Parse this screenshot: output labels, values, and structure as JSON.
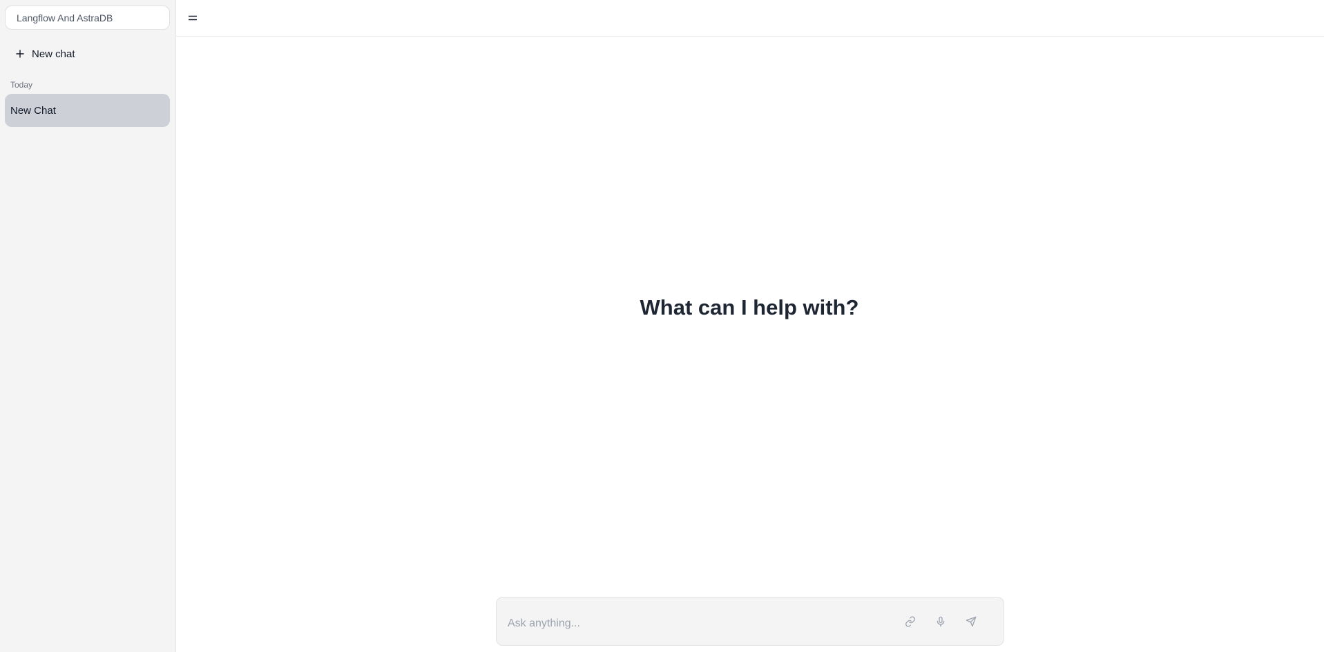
{
  "sidebar": {
    "project_name": "Langflow And AstraDB",
    "new_chat_label": "New chat",
    "section_today": "Today",
    "chats": [
      {
        "title": "New Chat",
        "selected": true
      }
    ]
  },
  "topbar": {
    "menu_icon": "menu-icon"
  },
  "main": {
    "headline": "What can I help with?"
  },
  "composer": {
    "placeholder": "Ask anything...",
    "value": "",
    "icons": [
      "link-icon",
      "microphone-icon",
      "send-icon"
    ]
  },
  "colors": {
    "sidebar_bg": "#f4f4f4",
    "selected_chat_bg": "#cdd1d7",
    "composer_bg": "#f4f4f4",
    "headline": "#1e2533",
    "icon_muted": "#9ca3af"
  }
}
